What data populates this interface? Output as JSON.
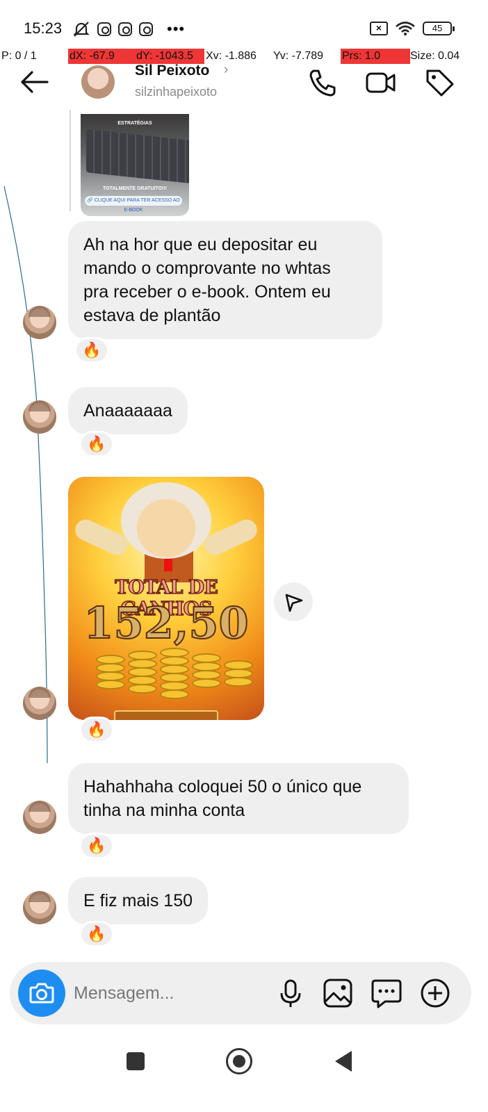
{
  "status_bar": {
    "time": "15:23",
    "battery": "45"
  },
  "debug_overlay": {
    "pointer": "P: 0 / 1",
    "dx": "dX: -67.9",
    "dy": "dY: -1043.5",
    "xv": "Xv: -1.886",
    "yv": "Yv: -7.789",
    "prs": "Prs: 1.0",
    "size": "Size: 0.04",
    "highlight_color": "#ee3636"
  },
  "header": {
    "name": "Sil Peixoto",
    "chevron": "›",
    "username": "silzinhapeixoto",
    "icons": [
      "back-arrow-icon",
      "phone-icon",
      "video-call-icon",
      "tag-icon"
    ]
  },
  "story_reply": {
    "caption_top": "ESTRATÉGIAS",
    "caption_bottom": "TOTALMENTE GRATUITO!!!",
    "link_label": "🔗 CLIQUE AQUI PARA TER ACESSO AO E-BOOK"
  },
  "messages": [
    {
      "text_lines": [
        "Ah na hor que eu depositar eu",
        "mando o comprovante no whtas",
        "pra receber o e-book. Ontem eu",
        "estava de plantão"
      ],
      "reaction": "🔥"
    },
    {
      "text_lines": [
        "Anaaaaaaa"
      ],
      "reaction": "🔥"
    },
    {
      "image": {
        "title": "TOTAL DE GANHOS",
        "value": "152,50"
      },
      "reaction": "🔥"
    },
    {
      "text_lines": [
        "Hahahhaha coloquei 50 o único que",
        "tinha na minha conta"
      ],
      "reaction": "🔥"
    },
    {
      "text_lines": [
        "E fiz mais 150"
      ],
      "reaction": "🔥"
    }
  ],
  "composer": {
    "placeholder": "Mensagem...",
    "icons": [
      "camera-icon",
      "microphone-icon",
      "gallery-icon",
      "sticker-chat-icon",
      "add-circle-icon"
    ],
    "accent": "#1d8df1"
  },
  "colors": {
    "bubble": "#efefef",
    "muted_text": "#8a8a8a"
  }
}
